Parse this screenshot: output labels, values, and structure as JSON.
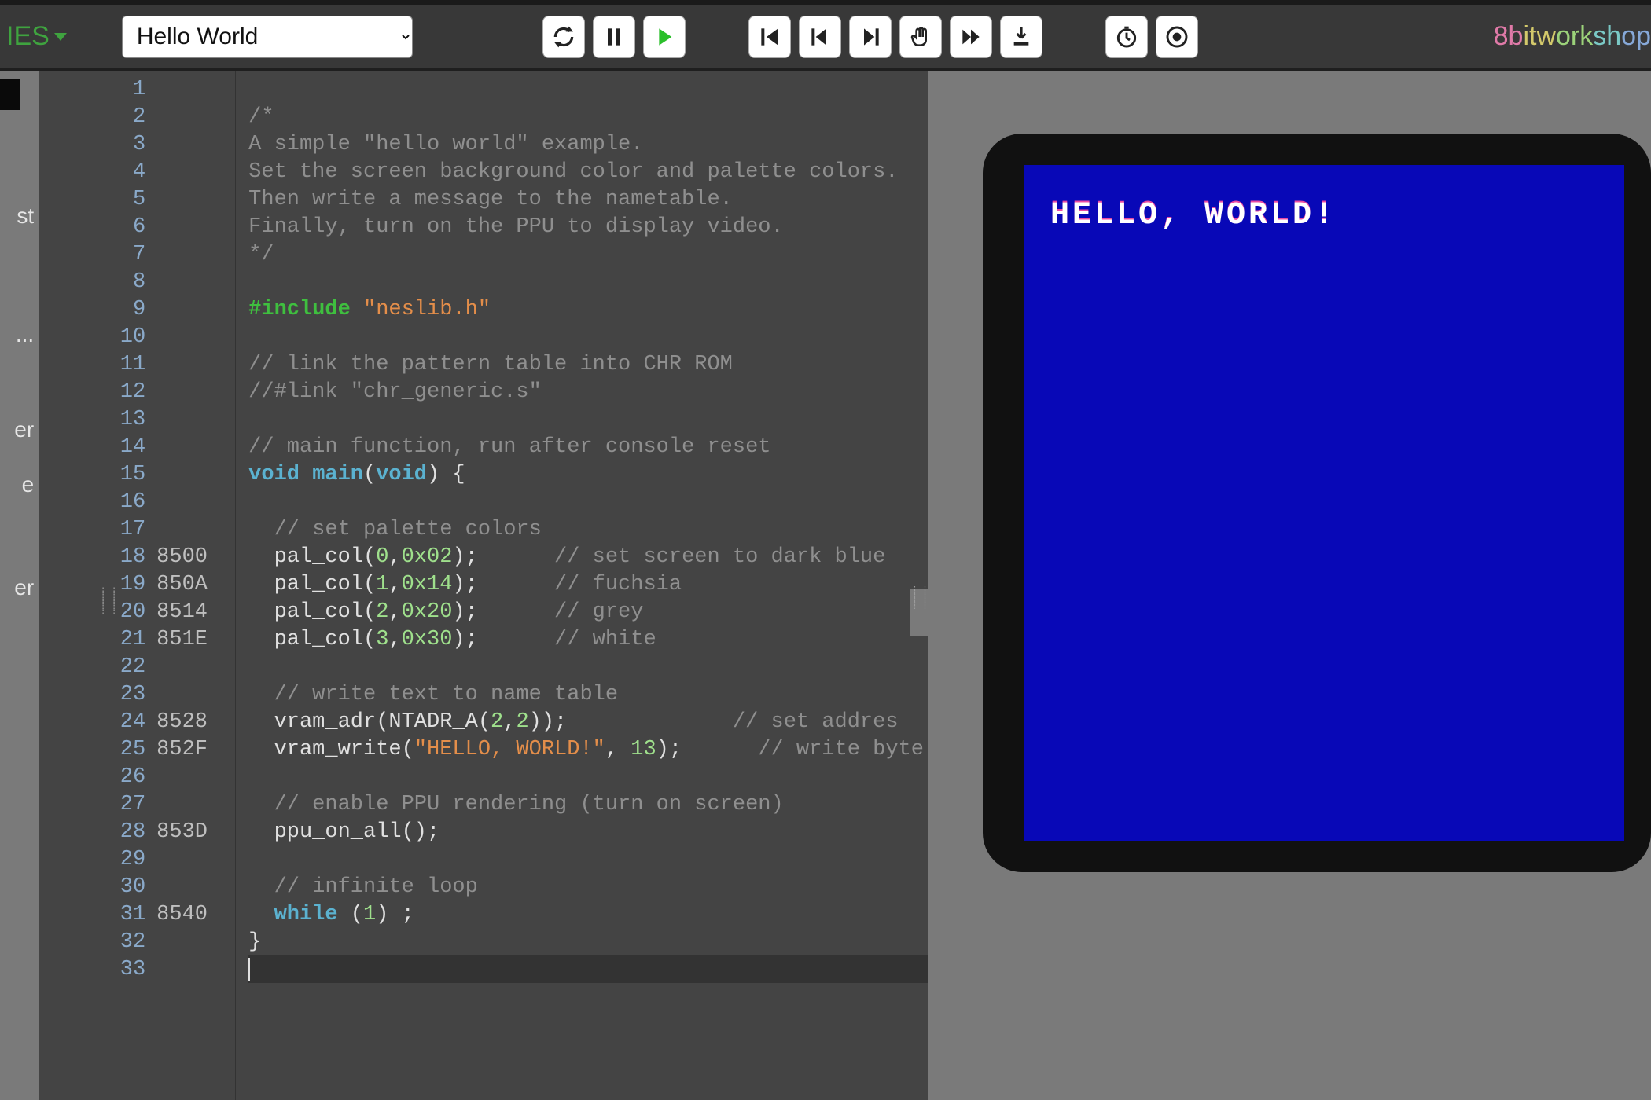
{
  "toolbar": {
    "platform_label": "IES",
    "file_select": {
      "value": "Hello World"
    },
    "buttons": {
      "rebuild": "Rebuild",
      "pause": "Pause",
      "play": "Play",
      "restart": "Restart",
      "step_back": "Step Back",
      "step": "Step",
      "step_out": "Step Out",
      "fast_forward": "Fast Forward",
      "download": "Download",
      "timing": "Timing",
      "record": "Record"
    },
    "brand": "8bitworkshop"
  },
  "sidebar": {
    "items": [
      {
        "label_tail": "st"
      },
      {
        "label_tail": "..."
      },
      {
        "label_tail": "er"
      },
      {
        "label_tail": "e"
      },
      {
        "label_tail": "er"
      }
    ]
  },
  "editor": {
    "addresses": {
      "18": "8500",
      "19": "850A",
      "20": "8514",
      "21": "851E",
      "24": "8528",
      "25": "852F",
      "28": "853D",
      "31": "8540"
    },
    "lines": [
      {
        "num": 1,
        "tokens": []
      },
      {
        "num": 2,
        "tokens": [
          {
            "t": "/*",
            "c": "comment"
          }
        ]
      },
      {
        "num": 3,
        "tokens": [
          {
            "t": "A simple \"hello world\" example.",
            "c": "comment"
          }
        ]
      },
      {
        "num": 4,
        "tokens": [
          {
            "t": "Set the screen background color and palette colors.",
            "c": "comment"
          }
        ]
      },
      {
        "num": 5,
        "tokens": [
          {
            "t": "Then write a message to the nametable.",
            "c": "comment"
          }
        ]
      },
      {
        "num": 6,
        "tokens": [
          {
            "t": "Finally, turn on the PPU to display video.",
            "c": "comment"
          }
        ]
      },
      {
        "num": 7,
        "tokens": [
          {
            "t": "*/",
            "c": "comment"
          }
        ]
      },
      {
        "num": 8,
        "tokens": []
      },
      {
        "num": 9,
        "tokens": [
          {
            "t": "#include ",
            "c": "pp"
          },
          {
            "t": "\"neslib.h\"",
            "c": "str"
          }
        ]
      },
      {
        "num": 10,
        "tokens": []
      },
      {
        "num": 11,
        "tokens": [
          {
            "t": "// link the pattern table into CHR ROM",
            "c": "comment"
          }
        ]
      },
      {
        "num": 12,
        "tokens": [
          {
            "t": "//#link \"chr_generic.s\"",
            "c": "comment"
          }
        ]
      },
      {
        "num": 13,
        "tokens": []
      },
      {
        "num": 14,
        "tokens": [
          {
            "t": "// main function, run after console reset",
            "c": "comment"
          }
        ]
      },
      {
        "num": 15,
        "tokens": [
          {
            "t": "void ",
            "c": "kw"
          },
          {
            "t": "main",
            "c": "fn"
          },
          {
            "t": "(",
            "c": "plain"
          },
          {
            "t": "void",
            "c": "kw"
          },
          {
            "t": ") {",
            "c": "plain"
          }
        ]
      },
      {
        "num": 16,
        "tokens": []
      },
      {
        "num": 17,
        "tokens": [
          {
            "t": "  ",
            "c": "plain"
          },
          {
            "t": "// set palette colors",
            "c": "comment"
          }
        ]
      },
      {
        "num": 18,
        "tokens": [
          {
            "t": "  pal_col(",
            "c": "plain"
          },
          {
            "t": "0",
            "c": "num"
          },
          {
            "t": ",",
            "c": "plain"
          },
          {
            "t": "0x02",
            "c": "num"
          },
          {
            "t": ");\t",
            "c": "plain"
          },
          {
            "t": "// set screen to dark blue",
            "c": "comment"
          }
        ]
      },
      {
        "num": 19,
        "tokens": [
          {
            "t": "  pal_col(",
            "c": "plain"
          },
          {
            "t": "1",
            "c": "num"
          },
          {
            "t": ",",
            "c": "plain"
          },
          {
            "t": "0x14",
            "c": "num"
          },
          {
            "t": ");\t",
            "c": "plain"
          },
          {
            "t": "// fuchsia",
            "c": "comment"
          }
        ]
      },
      {
        "num": 20,
        "tokens": [
          {
            "t": "  pal_col(",
            "c": "plain"
          },
          {
            "t": "2",
            "c": "num"
          },
          {
            "t": ",",
            "c": "plain"
          },
          {
            "t": "0x20",
            "c": "num"
          },
          {
            "t": ");\t",
            "c": "plain"
          },
          {
            "t": "// grey",
            "c": "comment"
          }
        ]
      },
      {
        "num": 21,
        "tokens": [
          {
            "t": "  pal_col(",
            "c": "plain"
          },
          {
            "t": "3",
            "c": "num"
          },
          {
            "t": ",",
            "c": "plain"
          },
          {
            "t": "0x30",
            "c": "num"
          },
          {
            "t": ");\t",
            "c": "plain"
          },
          {
            "t": "// white",
            "c": "comment"
          }
        ]
      },
      {
        "num": 22,
        "tokens": []
      },
      {
        "num": 23,
        "tokens": [
          {
            "t": "  ",
            "c": "plain"
          },
          {
            "t": "// write text to name table",
            "c": "comment"
          }
        ]
      },
      {
        "num": 24,
        "tokens": [
          {
            "t": "  vram_adr(NTADR_A(",
            "c": "plain"
          },
          {
            "t": "2",
            "c": "num"
          },
          {
            "t": ",",
            "c": "plain"
          },
          {
            "t": "2",
            "c": "num"
          },
          {
            "t": "));\t\t",
            "c": "plain"
          },
          {
            "t": "// set addres",
            "c": "comment"
          }
        ]
      },
      {
        "num": 25,
        "tokens": [
          {
            "t": "  vram_write(",
            "c": "plain"
          },
          {
            "t": "\"HELLO, WORLD!\"",
            "c": "str"
          },
          {
            "t": ", ",
            "c": "plain"
          },
          {
            "t": "13",
            "c": "num"
          },
          {
            "t": ");\t",
            "c": "plain"
          },
          {
            "t": "// write byte",
            "c": "comment"
          }
        ]
      },
      {
        "num": 26,
        "tokens": []
      },
      {
        "num": 27,
        "tokens": [
          {
            "t": "  ",
            "c": "plain"
          },
          {
            "t": "// enable PPU rendering (turn on screen)",
            "c": "comment"
          }
        ]
      },
      {
        "num": 28,
        "tokens": [
          {
            "t": "  ppu_on_all();",
            "c": "plain"
          }
        ]
      },
      {
        "num": 29,
        "tokens": []
      },
      {
        "num": 30,
        "tokens": [
          {
            "t": "  ",
            "c": "plain"
          },
          {
            "t": "// infinite loop",
            "c": "comment"
          }
        ]
      },
      {
        "num": 31,
        "tokens": [
          {
            "t": "  ",
            "c": "plain"
          },
          {
            "t": "while",
            "c": "kw"
          },
          {
            "t": " (",
            "c": "plain"
          },
          {
            "t": "1",
            "c": "num"
          },
          {
            "t": ") ;",
            "c": "plain"
          }
        ]
      },
      {
        "num": 32,
        "tokens": [
          {
            "t": "}",
            "c": "plain"
          }
        ]
      },
      {
        "num": 33,
        "tokens": [],
        "current": true
      }
    ]
  },
  "emulator": {
    "screen_text": "HELLO, WORLD!",
    "bg_color": "#0808b7"
  }
}
